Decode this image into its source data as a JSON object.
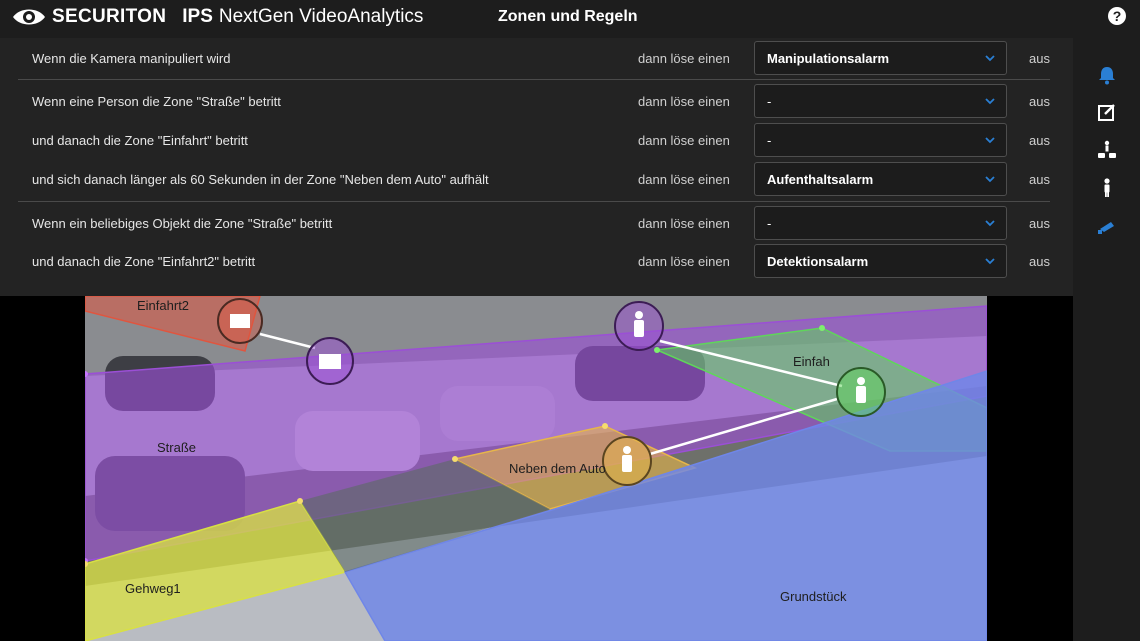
{
  "header": {
    "brand_name": "SECURITON",
    "brand_ips": "IPS",
    "brand_product": "NextGen VideoAnalytics",
    "title": "Zonen und Regeln",
    "help_label": "?"
  },
  "rules": [
    {
      "condition": "Wenn die Kamera manipuliert wird",
      "then": "dann löse einen",
      "alarm": "Manipulationsalarm",
      "suffix": "aus"
    },
    {
      "condition": "Wenn eine Person die Zone \"Straße\" betritt",
      "then": "dann löse einen",
      "alarm": "-",
      "suffix": "aus"
    },
    {
      "condition": "und danach die Zone \"Einfahrt\" betritt",
      "then": "dann löse einen",
      "alarm": "-",
      "suffix": "aus"
    },
    {
      "condition": "und sich danach länger als 60 Sekunden in der Zone \"Neben dem Auto\" aufhält",
      "then": "dann löse einen",
      "alarm": "Aufenthaltsalarm",
      "suffix": "aus"
    },
    {
      "condition": "Wenn ein beliebiges Objekt die Zone \"Straße\" betritt",
      "then": "dann löse einen",
      "alarm": "-",
      "suffix": "aus"
    },
    {
      "condition": "und danach die Zone \"Einfahrt2\" betritt",
      "then": "dann löse einen",
      "alarm": "Detektionsalarm",
      "suffix": "aus"
    }
  ],
  "sidebar_icons": [
    "bell-icon",
    "edit-icon",
    "zone-objects-icon",
    "person-icon",
    "camera-icon"
  ],
  "zones": {
    "einfahrt2": "Einfahrt2",
    "strasse": "Straße",
    "einfahrt": "Einfah",
    "neben_dem_auto": "Neben dem Auto",
    "gehweg": "Gehweg1",
    "grundstueck": "Grundstück"
  },
  "colors": {
    "accent": "#2a7fd4",
    "panel": "#232323",
    "topbar": "#1d1d1d",
    "zone_purple": "#9b4fd6",
    "zone_green": "#5fd65a",
    "zone_yellow": "#d8e044",
    "zone_orange": "#e7b64a",
    "zone_blue": "#6f86e8",
    "zone_red": "#e0553f"
  }
}
